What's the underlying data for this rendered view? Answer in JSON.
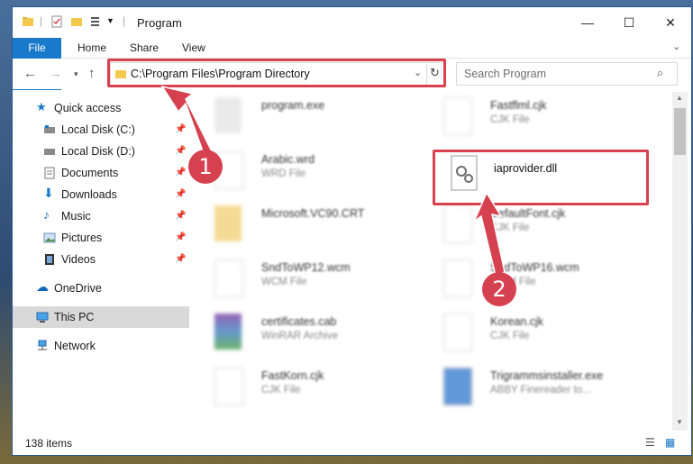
{
  "window": {
    "title": "Program"
  },
  "ribbon": {
    "tabs": [
      "File",
      "Home",
      "Share",
      "View"
    ]
  },
  "address": {
    "path": "C:\\Program Files\\Program Directory"
  },
  "search": {
    "placeholder": "Search Program"
  },
  "nav": {
    "items": [
      {
        "label": "Quick access",
        "icon": "star-icon"
      },
      {
        "label": "Local Disk (C:)",
        "icon": "drive-icon"
      },
      {
        "label": "Local Disk (D:)",
        "icon": "drive-icon"
      },
      {
        "label": "Documents",
        "icon": "documents-icon"
      },
      {
        "label": "Downloads",
        "icon": "download-icon"
      },
      {
        "label": "Music",
        "icon": "music-icon"
      },
      {
        "label": "Pictures",
        "icon": "pictures-icon"
      },
      {
        "label": "Videos",
        "icon": "videos-icon"
      },
      {
        "label": "OneDrive",
        "icon": "cloud-icon"
      },
      {
        "label": "This PC",
        "icon": "computer-icon"
      },
      {
        "label": "Network",
        "icon": "network-icon"
      }
    ]
  },
  "files": [
    {
      "name": "program.exe",
      "type": ""
    },
    {
      "name": "Fastflml.cjk",
      "type": "CJK File"
    },
    {
      "name": "Arabic.wrd",
      "type": "WRD File"
    },
    {
      "name": "iaprovider.dll",
      "type": ""
    },
    {
      "name": "Microsoft.VC90.CRT",
      "type": ""
    },
    {
      "name": "DefaultFont.cjk",
      "type": "CJK File"
    },
    {
      "name": "SndToWP12.wcm",
      "type": "WCM File"
    },
    {
      "name": "SndToWP16.wcm",
      "type": "WCM File"
    },
    {
      "name": "certificates.cab",
      "type": "WinRAR Archive"
    },
    {
      "name": "Korean.cjk",
      "type": "CJK File"
    },
    {
      "name": "FastKorn.cjk",
      "type": "CJK File"
    },
    {
      "name": "Trigrammsinstaller.exe",
      "type": "ABBY Finereader to..."
    }
  ],
  "status": {
    "count": "138 items"
  },
  "callouts": {
    "one": "1",
    "two": "2"
  },
  "colors": {
    "accent": "#1979ca",
    "highlight": "#d9414f"
  }
}
